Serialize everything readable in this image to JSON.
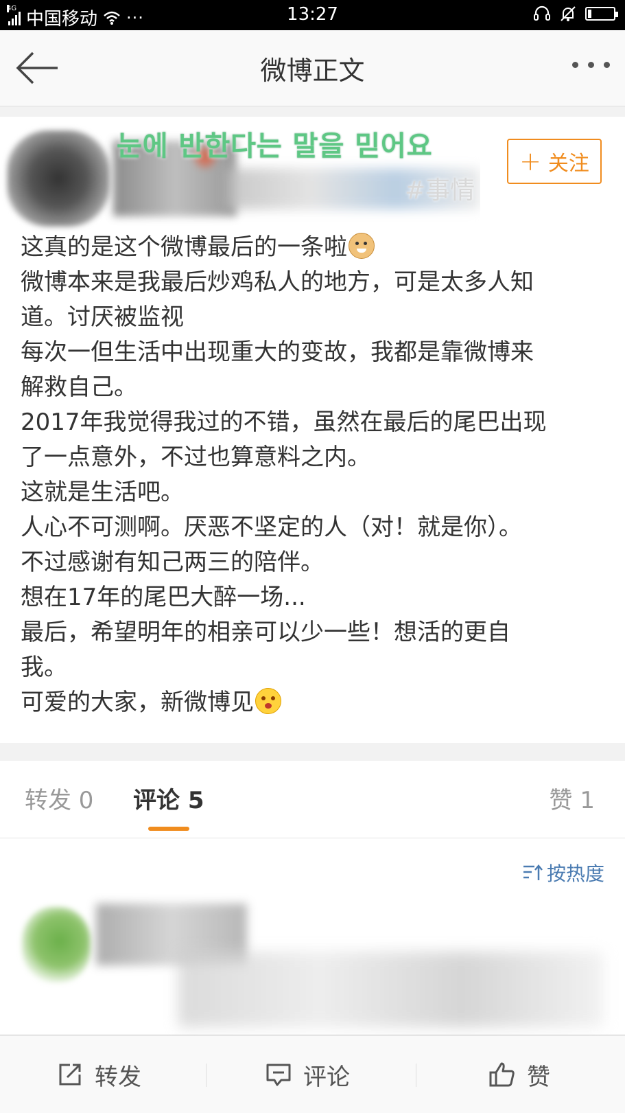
{
  "status_bar": {
    "network": "4G",
    "carrier": "中国移动",
    "extra": "···",
    "time": "13:27",
    "battery_level": 0.15
  },
  "nav": {
    "title": "微博正文",
    "back_icon": "arrow-left-icon",
    "more_icon": "more-dots-icon"
  },
  "post": {
    "header_overlay_text": "눈에 반한다는 말을 믿어요",
    "header_tag_text": "#事情",
    "follow_label": "关注",
    "lines": [
      "这真的是这个微博最后的一条啦",
      "微博本来是我最后炒鸡私人的地方，可是太多人知",
      "道。讨厌被监视",
      "每次一但生活中出现重大的变故，我都是靠微博来",
      "解救自己。",
      "2017年我觉得我过的不错，虽然在最后的尾巴出现",
      "了一点意外，不过也算意料之内。",
      "这就是生活吧。",
      "人心不可测啊。厌恶不坚定的人（对！就是你）。",
      "不过感谢有知己两三的陪伴。",
      "想在17年的尾巴大醉一场...",
      "最后，希望明年的相亲可以少一些！想活的更自",
      "我。",
      "可爱的大家，新微博见"
    ]
  },
  "tabs": {
    "repost": "转发 0",
    "comments": "评论 5",
    "likes": "赞 1"
  },
  "comments": {
    "sort_label": "按热度"
  },
  "bottom_bar": {
    "repost": "转发",
    "comment": "评论",
    "like": "赞"
  },
  "colors": {
    "accent": "#f08c1e",
    "link": "#4a7bb1"
  }
}
